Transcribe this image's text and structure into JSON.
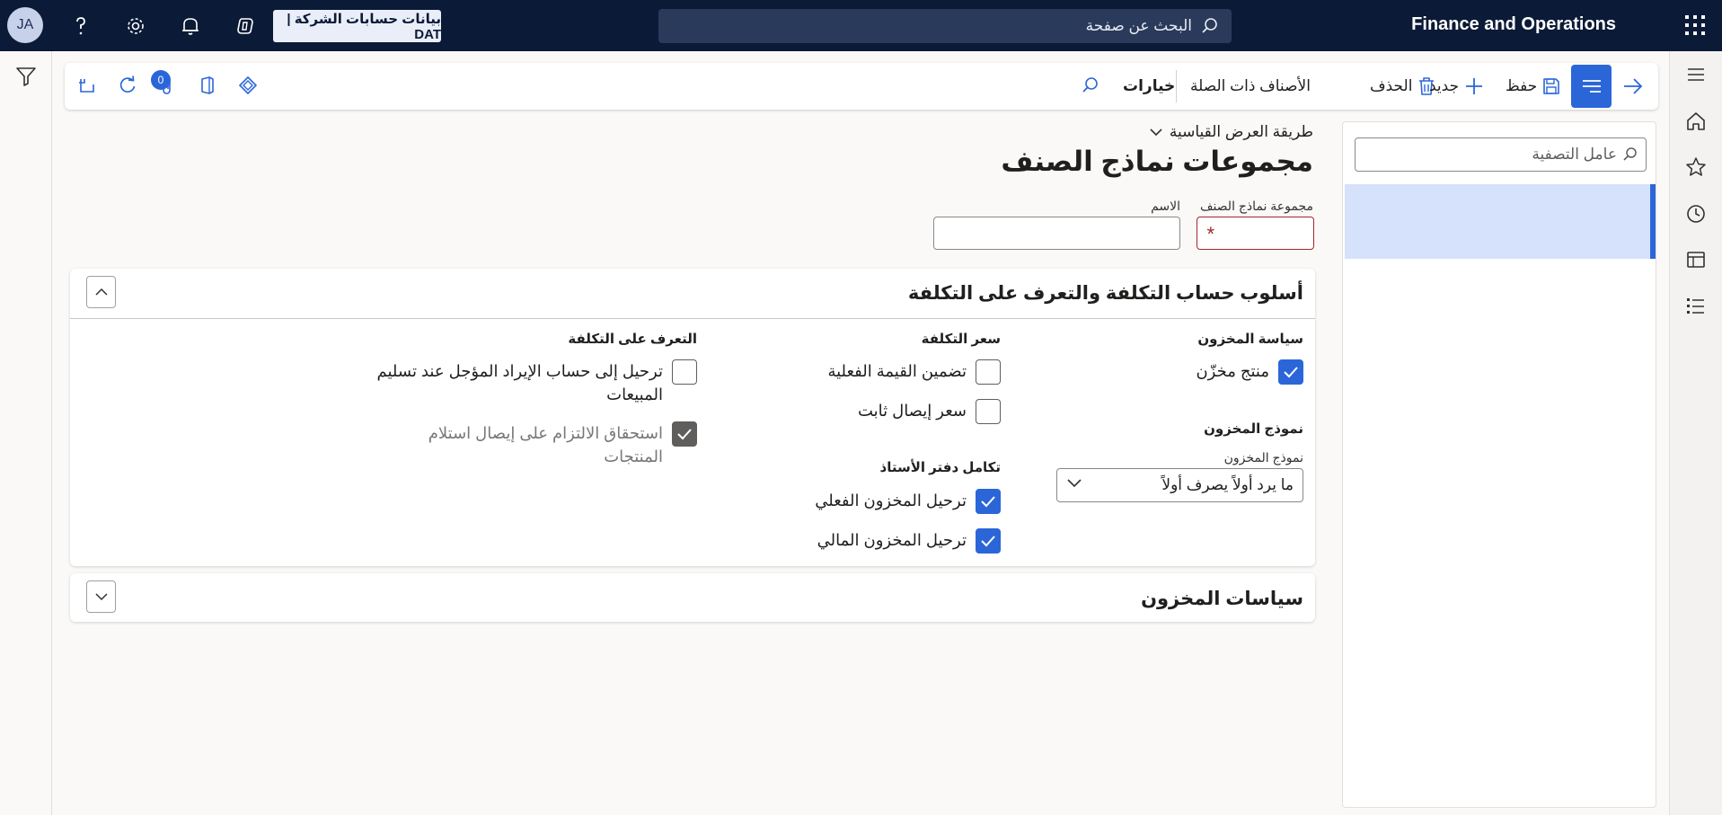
{
  "topbar": {
    "avatar_initials": "JA",
    "company_button": "بيانات حسابات الشركة | DAT",
    "search_placeholder": "البحث عن صفحة",
    "app_title": "Finance and Operations",
    "icons": [
      "help-icon",
      "settings-icon",
      "notifications-icon",
      "copilot-icon",
      "waffle-icon"
    ]
  },
  "action_pane": {
    "save": "حفظ",
    "new": "جديد",
    "delete": "الحذف",
    "related_items": "الأصناف ذات الصلة",
    "options": "خيارات",
    "attachments_count": "0"
  },
  "list_panel": {
    "filter_placeholder": "عامل التصفية"
  },
  "header": {
    "view_mode": "طريقة العرض القياسية",
    "page_title": "مجموعات نماذج الصنف",
    "group_label": "مجموعة نماذج الصنف",
    "group_value": "",
    "name_label": "الاسم",
    "name_value": ""
  },
  "fasttab_costing": {
    "title": "أسلوب حساب التكلفة والتعرف على التكلفة",
    "expanded": true,
    "inventory_policy": {
      "title": "سياسة المخزون",
      "stocked_product": {
        "label": "منتج مخزّن",
        "checked": true
      }
    },
    "inventory_model_group": {
      "title": "نموذج المخزون",
      "field_label": "نموذج المخزون",
      "selected": "ما يرد أولاً يصرف أولاً"
    },
    "cost_price": {
      "title": "سعر التكلفة",
      "include_physical_value": {
        "label": "تضمين القيمة الفعلية",
        "checked": false
      },
      "fixed_receipt_price": {
        "label": "سعر إيصال ثابت",
        "checked": false
      }
    },
    "ledger_integration": {
      "title": "تكامل دفتر الأستاذ",
      "post_physical_inventory": {
        "label": "ترحيل المخزون الفعلي",
        "checked": true
      },
      "post_financial_inventory": {
        "label": "ترحيل المخزون المالي",
        "checked": true
      }
    },
    "cost_recognition": {
      "title": "التعرف على التكلفة",
      "post_deferred_revenue_line1": "ترحيل إلى حساب الإيراد المؤجل عند تسليم",
      "post_deferred_revenue_line2": "المبيعات",
      "post_deferred_revenue_checked": false,
      "accrue_liability_line1": "استحقاق الالتزام على إيصال استلام",
      "accrue_liability_line2": "المنتجات",
      "accrue_liability_checked": true
    }
  },
  "fasttab_inventory_policies": {
    "title": "سياسات المخزون",
    "expanded": false
  },
  "colors": {
    "topbar_bg": "#0b1a36",
    "accent": "#2b66d9",
    "selection": "#d6e2fb"
  }
}
